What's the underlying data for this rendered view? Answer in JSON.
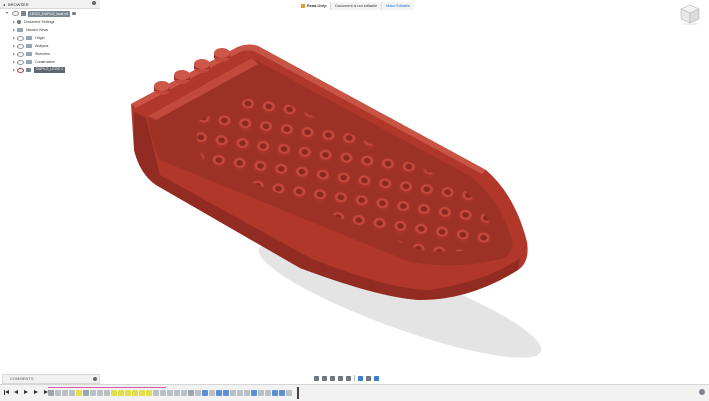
{
  "browser": {
    "title": "BROWSER"
  },
  "tree": {
    "root_label": "LEGO_DUPLO_boat v4",
    "items": [
      {
        "label": "Document Settings"
      },
      {
        "label": "Named Views"
      },
      {
        "label": "Origin"
      },
      {
        "label": "Analysis"
      },
      {
        "label": "Sketches"
      },
      {
        "label": "Construction"
      },
      {
        "label": "DUPLO_LEGO 1"
      }
    ]
  },
  "banner": {
    "readonly_label": "Read-Only:",
    "not_editable": "Document is not editable",
    "make_editable": "Make Editable"
  },
  "comments": {
    "title": "COMMENTS"
  },
  "colors": {
    "boat": "#b0372a",
    "boat_dark": "#8f2a20",
    "boat_light": "#c2493b",
    "accent": "#1f6fd1"
  },
  "icons": {
    "viewcube": "viewcube-icon",
    "settings": "gear-icon"
  }
}
